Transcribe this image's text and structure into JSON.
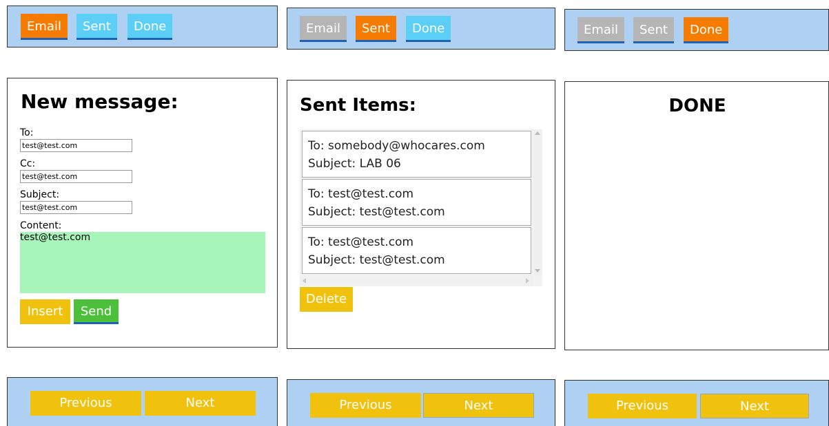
{
  "panels": [
    {
      "tabs": [
        "Email",
        "Sent",
        "Done"
      ],
      "title": "New message:",
      "form": {
        "to_label": "To:",
        "to_value": "test@test.com",
        "cc_label": "Cc:",
        "cc_value": "test@test.com",
        "subject_label": "Subject:",
        "subject_value": "test@test.com",
        "content_label": "Content:",
        "content_value": "test@test.com"
      },
      "insert_label": "Insert",
      "send_label": "Send",
      "nav": {
        "previous": "Previous",
        "next": "Next"
      }
    },
    {
      "tabs": [
        "Email",
        "Sent",
        "Done"
      ],
      "title": "Sent Items:",
      "items": [
        {
          "to": "To: somebody@whocares.com",
          "subject": "Subject: LAB 06"
        },
        {
          "to": "To: test@test.com",
          "subject": "Subject: test@test.com"
        },
        {
          "to": "To: test@test.com",
          "subject": "Subject: test@test.com"
        }
      ],
      "delete_label": "Delete",
      "nav": {
        "previous": "Previous",
        "next": "Next"
      }
    },
    {
      "tabs": [
        "Email",
        "Sent",
        "Done"
      ],
      "title": "DONE",
      "nav": {
        "previous": "Previous",
        "next": "Next"
      }
    }
  ],
  "colors": {
    "bar_bg": "#aed0f2",
    "tab_active": "#f57c00",
    "tab_inactive_light": "#5bcff5",
    "tab_inactive_gray": "#b5b5b5",
    "nav_button": "#f0c20e",
    "send_button": "#4cc03a",
    "content_bg": "#a8f5bb"
  }
}
